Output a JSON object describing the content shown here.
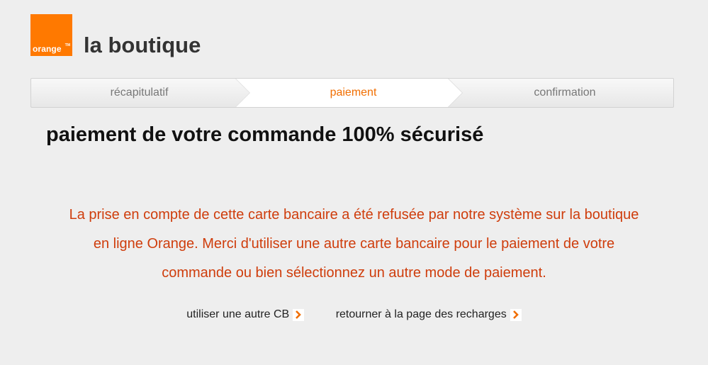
{
  "header": {
    "logo_text": "orange",
    "logo_tm": "TM",
    "title": "la boutique"
  },
  "steps": [
    {
      "label": "récapitulatif",
      "state": "done"
    },
    {
      "label": "paiement",
      "state": "active"
    },
    {
      "label": "confirmation",
      "state": "pending"
    }
  ],
  "main": {
    "heading": "paiement de votre commande 100% sécurisé",
    "error_lines": [
      "La prise en compte de cette carte bancaire a été refusée par notre système sur la boutique",
      "en ligne Orange. Merci d'utiliser une autre carte bancaire pour le paiement de votre",
      "commande ou bien sélectionnez un autre mode de paiement."
    ]
  },
  "actions": {
    "other_card": "utiliser une autre CB",
    "back_to_recharges": "retourner à la page des recharges",
    "arrow_icon": "chevron-right-icon"
  },
  "colors": {
    "brand": "#ff7900",
    "active_step": "#f16e00",
    "error_text": "#cf3d0c",
    "background": "#eeeeee"
  }
}
